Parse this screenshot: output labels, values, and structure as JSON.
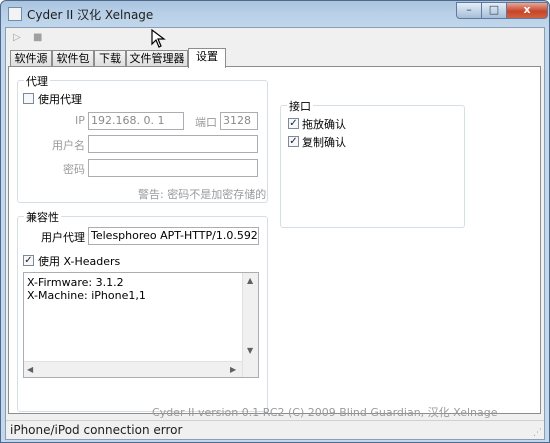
{
  "window": {
    "title": "Cyder II 汉化 Xelnage"
  },
  "window_controls": {
    "minimize": "–",
    "maximize": "□",
    "close": "x"
  },
  "toolbar": {
    "play_icon": "▷",
    "stop_icon": "■"
  },
  "tabs": [
    {
      "label": "软件源"
    },
    {
      "label": "软件包"
    },
    {
      "label": "下载"
    },
    {
      "label": "文件管理器"
    },
    {
      "label": "设置"
    }
  ],
  "proxy": {
    "legend": "代理",
    "use_proxy_label": "使用代理",
    "use_proxy_checked": false,
    "ip_label": "IP",
    "ip_value": "192.168.  0.  1",
    "port_label": "端口",
    "port_value": "3128",
    "username_label": "用户名",
    "username_value": "",
    "password_label": "密码",
    "password_value": "",
    "warning": "警告: 密码不是加密存储的"
  },
  "interface": {
    "legend": "接口",
    "drag_confirm_label": "拖放确认",
    "drag_confirm_checked": true,
    "copy_confirm_label": "复制确认",
    "copy_confirm_checked": true
  },
  "compat": {
    "legend": "兼容性",
    "user_agent_label": "用户代理",
    "user_agent_value": "Telesphoreo APT-HTTP/1.0.592",
    "use_xheaders_label": "使用 X-Headers",
    "use_xheaders_checked": true,
    "headers_lines": [
      "X-Firmware: 3.1.2",
      "X-Machine: iPhone1,1"
    ]
  },
  "footer": {
    "credits": "Cyder II version 0.1 RC2 (C) 2009 Blind Guardian, 汉化 Xelnage"
  },
  "status": {
    "text": "iPhone/iPod connection error"
  },
  "checkmark": "✓",
  "scroll": {
    "up": "▲",
    "down": "▼",
    "left": "◀",
    "right": "▶"
  }
}
